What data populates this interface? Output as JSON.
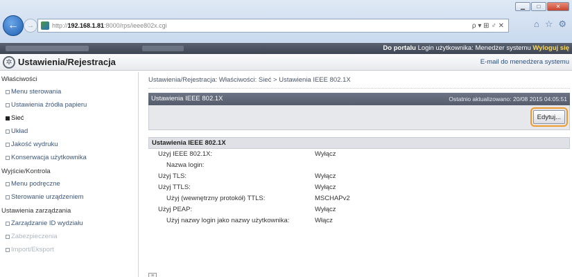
{
  "browser": {
    "url_prefix": "http://",
    "url_host": "192.168.1.81",
    "url_rest": ":8000/rps/ieee802x.cgi",
    "search_tools": "ρ ▾ ⊞ ♂ ✕",
    "icons": [
      "home-icon",
      "star-icon",
      "gear-icon"
    ]
  },
  "portal": {
    "to_portal": "Do portalu",
    "login_label": "Login użytkownika: Menedżer systemu",
    "logout": "Wyloguj się"
  },
  "header": {
    "title": "Ustawienia/Rejestracja",
    "mail_link": "E-mail do menedżera systemu"
  },
  "sidebar": {
    "groups": [
      {
        "label": "Właściwości",
        "items": [
          {
            "label": "Menu sterowania",
            "active": false
          },
          {
            "label": "Ustawienia źródła papieru",
            "active": false
          },
          {
            "label": "Sieć",
            "active": true
          },
          {
            "label": "Układ",
            "active": false
          },
          {
            "label": "Jakość wydruku",
            "active": false
          },
          {
            "label": "Konserwacja użytkownika",
            "active": false
          }
        ]
      },
      {
        "label": "Wyjście/Kontrola",
        "items": [
          {
            "label": "Menu podręczne",
            "active": false
          },
          {
            "label": "Sterowanie urządzeniem",
            "active": false
          }
        ]
      },
      {
        "label": "Ustawienia zarządzania",
        "items": [
          {
            "label": "Zarządzanie ID wydziału",
            "active": false
          },
          {
            "label": "Zabezpieczenia",
            "active": false
          },
          {
            "label": "Import/Eksport",
            "active": false
          }
        ]
      }
    ]
  },
  "main": {
    "breadcrumb": "Ustawienia/Rejestracja: Właściwości: Sieć > Ustawienia IEEE 802.1X",
    "panel_title": "Ustawienia IEEE 802.1X",
    "last_updated": "Ostatnio aktualizowano: 20/08 2015 04:05:51",
    "edit_button": "Edytuj...",
    "section_title": "Ustawienia IEEE 802.1X",
    "rows": [
      {
        "label": "Użyj IEEE 802.1X:",
        "value": "Wyłącz",
        "sub": false
      },
      {
        "label": "Nazwa login:",
        "value": "",
        "sub": true
      },
      {
        "label": "Użyj TLS:",
        "value": "Wyłącz",
        "sub": false
      },
      {
        "label": "Użyj TTLS:",
        "value": "Wyłącz",
        "sub": false
      },
      {
        "label": "Użyj (wewnętrzny protokół) TTLS:",
        "value": "MSCHAPv2",
        "sub": true
      },
      {
        "label": "Użyj PEAP:",
        "value": "Wyłącz",
        "sub": false
      },
      {
        "label": "Użyj nazwy login jako nazwy użytkownika:",
        "value": "Włącz",
        "sub": true
      }
    ]
  }
}
